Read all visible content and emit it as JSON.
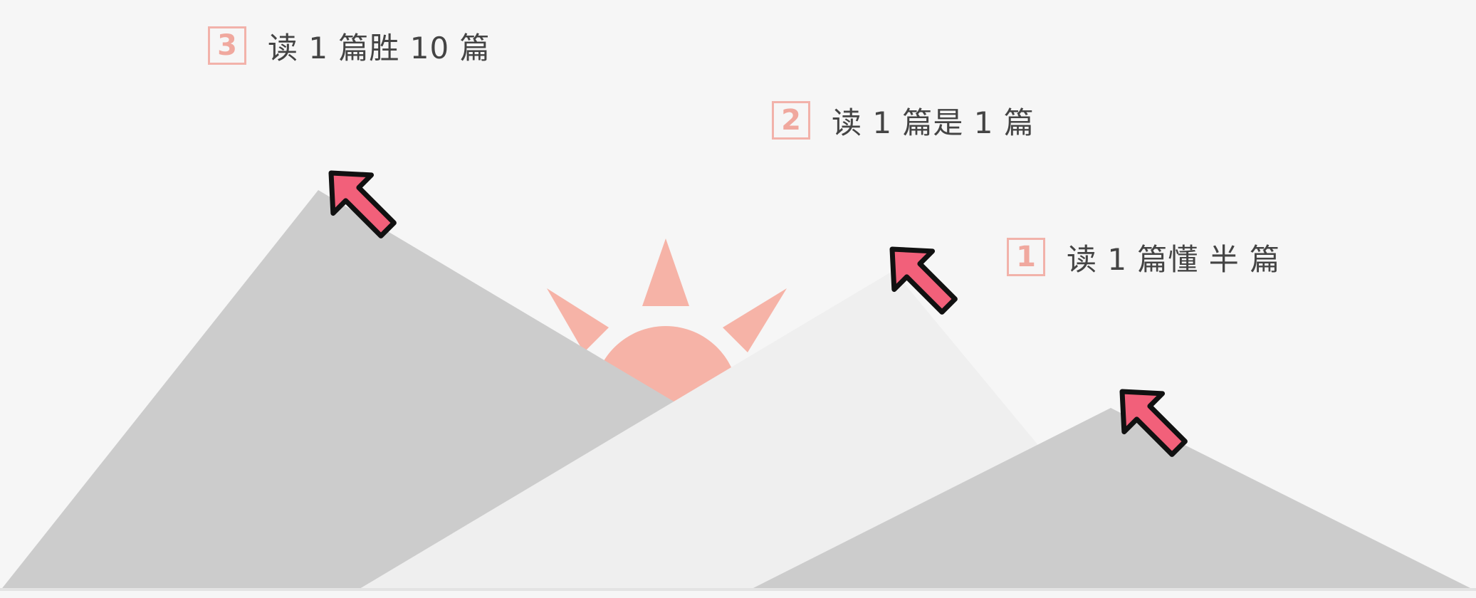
{
  "labels": [
    {
      "id": "1",
      "number": "1",
      "text": "读 1 篇懂 半 篇"
    },
    {
      "id": "2",
      "number": "2",
      "text": "读 1 篇是 1 篇"
    },
    {
      "id": "3",
      "number": "3",
      "text": "读 1 篇胜 10 篇"
    }
  ],
  "colors": {
    "background": "#f6f6f6",
    "mountain_dark": "#cccccc",
    "mountain_light": "#efefef",
    "sun": "#f6b3a7",
    "arrow_fill": "#f2607a",
    "arrow_stroke": "#111111",
    "badge": "#f0a89e",
    "text": "#444444"
  }
}
